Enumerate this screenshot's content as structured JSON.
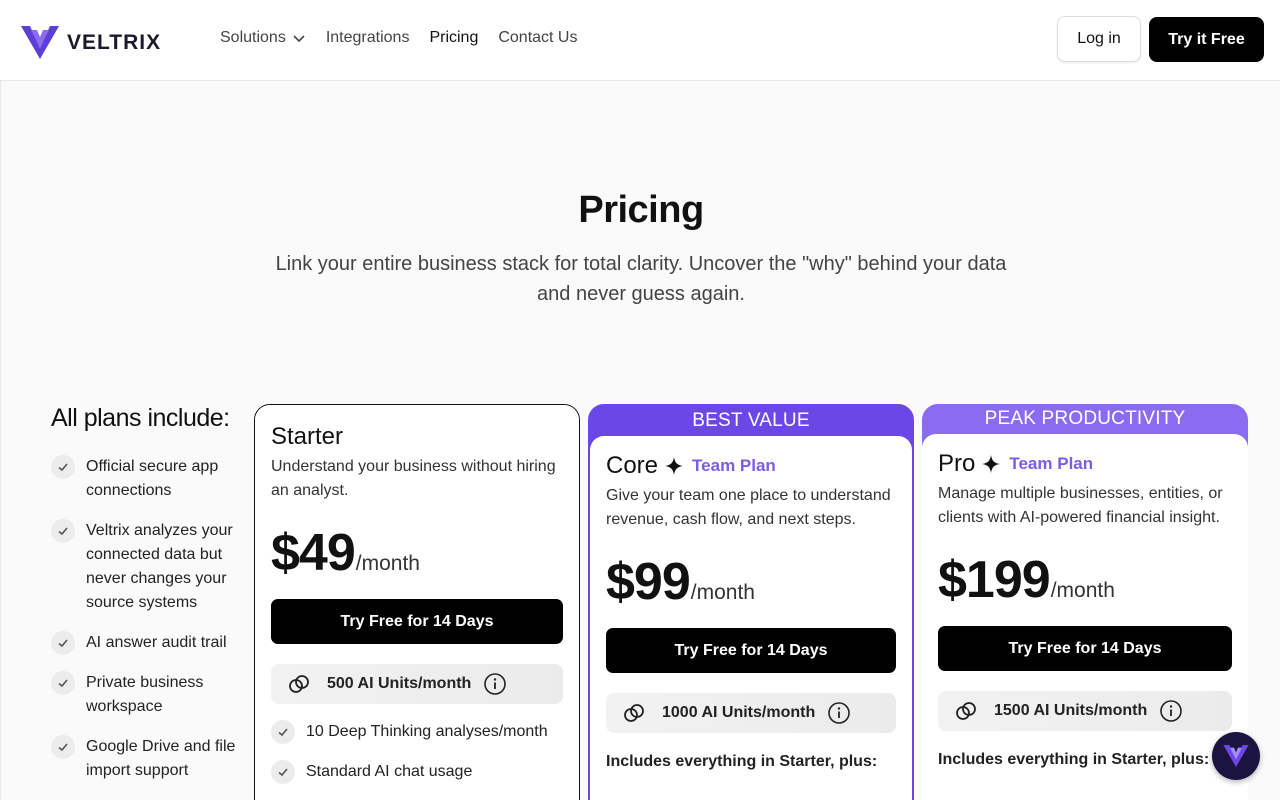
{
  "brand": {
    "name": "VELTRIX",
    "accent": "#6c47e8"
  },
  "nav": {
    "items": [
      {
        "label": "Solutions",
        "has_dropdown": true
      },
      {
        "label": "Integrations"
      },
      {
        "label": "Pricing",
        "active": true
      },
      {
        "label": "Contact Us"
      }
    ],
    "login_label": "Log in",
    "try_label": "Try it Free"
  },
  "hero": {
    "title": "Pricing",
    "subtitle": "Link your entire business stack for total clarity. Uncover the \"why\" behind your data and never guess again."
  },
  "includes": {
    "title": "All plans include:",
    "items": [
      "Official secure app connections",
      "Veltrix analyzes your connected data but never changes your source systems",
      "AI answer audit trail",
      "Private business workspace",
      "Google Drive and file import support"
    ]
  },
  "plans": [
    {
      "name": "Starter",
      "banner": "",
      "team_label": "",
      "description": "Understand your business without hiring an analyst.",
      "price": "$49",
      "period": "/month",
      "cta": "Try Free for 14 Days",
      "units": "500 AI Units/month",
      "features": [
        "10 Deep Thinking analyses/month",
        "Standard AI chat usage"
      ]
    },
    {
      "name": "Core",
      "banner": "BEST VALUE",
      "team_label": "Team Plan",
      "description": "Give your team one place to understand revenue, cash flow, and next steps.",
      "price": "$99",
      "period": "/month",
      "cta": "Try Free for 14 Days",
      "units": "1000 AI Units/month",
      "includes_label": "Includes everything in Starter, plus:"
    },
    {
      "name": "Pro",
      "banner": "PEAK PRODUCTIVITY",
      "team_label": "Team Plan",
      "description": "Manage multiple businesses, entities, or clients with AI-powered financial insight.",
      "price": "$199",
      "period": "/month",
      "cta": "Try Free for 14 Days",
      "units": "1500 AI Units/month",
      "includes_label": "Includes everything in Starter, plus:"
    }
  ],
  "icons": {
    "logo": "veltrix-v-logo",
    "check": "check-icon",
    "units": "link-rings-icon",
    "info": "info-icon",
    "spark": "sparkle-icon",
    "chat": "chat-launcher-icon"
  }
}
